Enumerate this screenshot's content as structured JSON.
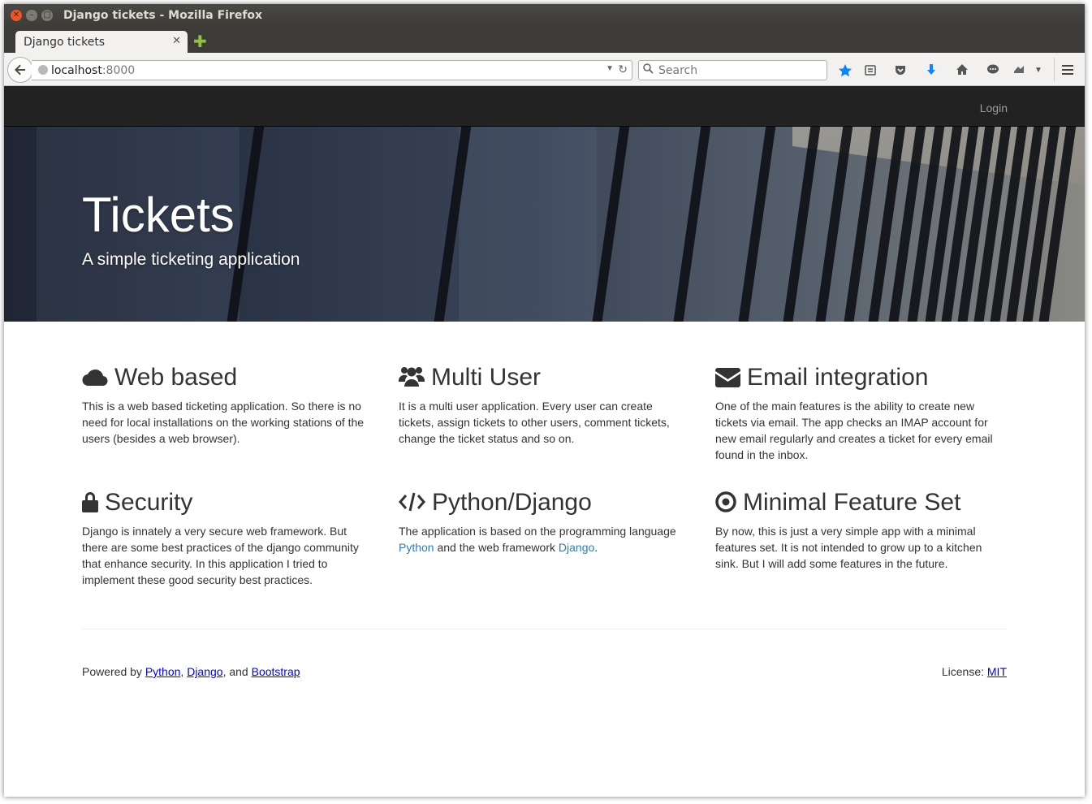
{
  "window": {
    "title": "Django tickets - Mozilla Firefox"
  },
  "tabs": [
    {
      "title": "Django tickets",
      "close": "✕"
    }
  ],
  "newtab": "✚",
  "urlbar": {
    "host": "localhost",
    "port": ":8000"
  },
  "search": {
    "placeholder": "Search"
  },
  "site": {
    "nav": {
      "login": "Login"
    },
    "hero": {
      "title": "Tickets",
      "subtitle": "A simple ticketing application"
    },
    "features": [
      {
        "icon": "cloud-icon",
        "title": "Web based",
        "text": "This is a web based ticketing application. So there is no need for local installations on the working stations of the users (besides a web browser)."
      },
      {
        "icon": "users-icon",
        "title": "Multi User",
        "text": "It is a multi user application. Every user can create tickets, assign tickets to other users, comment tickets, change the ticket status and so on."
      },
      {
        "icon": "envelope-icon",
        "title": "Email integration",
        "text": "One of the main features is the ability to create new tickets via email. The app checks an IMAP account for new email regularly and creates a ticket for every email found in the inbox."
      },
      {
        "icon": "lock-icon",
        "title": "Security",
        "text": "Django is innately a very secure web framework. But there are some best practices of the django community that enhance security. In this application I tried to implement these good security best practices."
      },
      {
        "icon": "code-icon",
        "title": "Python/Django",
        "text_before": "The application is based on the programming language",
        "link1": "Python",
        "text_middle": "and the web framework",
        "link2": "Django",
        "text_after": "."
      },
      {
        "icon": "bullseye-icon",
        "title": "Minimal Feature Set",
        "text": "By now, this is just a very simple app with a minimal features set. It is not intended to grow up to a kitchen sink. But I will add some features in the future."
      }
    ],
    "footer": {
      "powered_prefix": "Powered by",
      "python": "Python",
      "sep1": ",",
      "django": "Django",
      "sep2": ", and",
      "bootstrap": "Bootstrap",
      "license_label": "License:",
      "license": "MIT"
    }
  },
  "colors": {
    "link": "#337ab7",
    "navbar": "#222222",
    "bookmark_star": "#0a84ff"
  }
}
